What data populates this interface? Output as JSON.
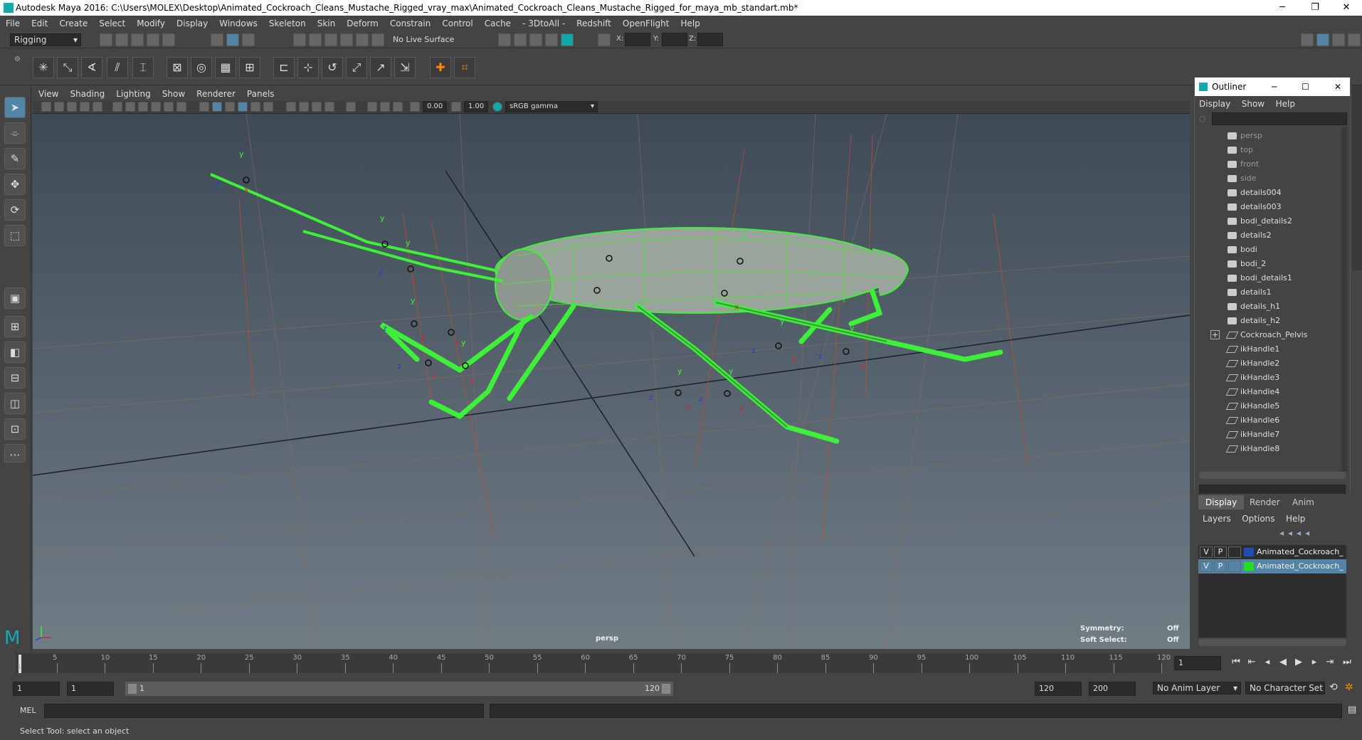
{
  "window": {
    "title": "Autodesk Maya 2016: C:\\Users\\MOLEX\\Desktop\\Animated_Cockroach_Cleans_Mustache_Rigged_vray_max\\Animated_Cockroach_Cleans_Mustache_Rigged_for_maya_mb_standart.mb*",
    "minimize": "─",
    "restore": "❐",
    "close": "✕"
  },
  "menubar": [
    "File",
    "Edit",
    "Create",
    "Select",
    "Modify",
    "Display",
    "Windows",
    "Skeleton",
    "Skin",
    "Deform",
    "Constrain",
    "Control",
    "Cache",
    "- 3DtoAll -",
    "Redshift",
    "OpenFlight",
    "Help"
  ],
  "statusline": {
    "menuset": "Rigging",
    "live_surface": "No Live Surface",
    "x_label": "X:",
    "y_label": "Y:",
    "z_label": "Z:"
  },
  "panel": {
    "menu": [
      "View",
      "Shading",
      "Lighting",
      "Show",
      "Renderer",
      "Panels"
    ],
    "near": "0.00",
    "far": "1.00",
    "colorspace": "sRGB gamma"
  },
  "viewport": {
    "camera_label": "persp",
    "symmetry_label": "Symmetry:",
    "symmetry_value": "Off",
    "softselect_label": "Soft Select:",
    "softselect_value": "Off"
  },
  "outliner": {
    "title": "Outliner",
    "menu": [
      "Display",
      "Show",
      "Help"
    ],
    "items": [
      {
        "label": "persp",
        "type": "cam"
      },
      {
        "label": "top",
        "type": "cam"
      },
      {
        "label": "front",
        "type": "cam"
      },
      {
        "label": "side",
        "type": "cam"
      },
      {
        "label": "details004",
        "type": "mesh"
      },
      {
        "label": "details003",
        "type": "mesh"
      },
      {
        "label": "bodi_details2",
        "type": "mesh"
      },
      {
        "label": "details2",
        "type": "mesh"
      },
      {
        "label": "bodi",
        "type": "mesh"
      },
      {
        "label": "bodi_2",
        "type": "mesh"
      },
      {
        "label": "bodi_details1",
        "type": "mesh"
      },
      {
        "label": "details1",
        "type": "mesh"
      },
      {
        "label": "details_h1",
        "type": "mesh"
      },
      {
        "label": "details_h2",
        "type": "mesh"
      },
      {
        "label": "Cockroach_Pelvis",
        "type": "joint",
        "expand": "+"
      },
      {
        "label": "ikHandle1",
        "type": "joint"
      },
      {
        "label": "ikHandle2",
        "type": "joint"
      },
      {
        "label": "ikHandle3",
        "type": "joint"
      },
      {
        "label": "ikHandle4",
        "type": "joint"
      },
      {
        "label": "ikHandle5",
        "type": "joint"
      },
      {
        "label": "ikHandle6",
        "type": "joint"
      },
      {
        "label": "ikHandle7",
        "type": "joint"
      },
      {
        "label": "ikHandle8",
        "type": "joint"
      }
    ]
  },
  "layers": {
    "tabs": [
      "Display",
      "Render",
      "Anim"
    ],
    "menu": [
      "Layers",
      "Options",
      "Help"
    ],
    "rows": [
      {
        "v": "V",
        "p": "P",
        "color": "#1d4fb8",
        "name": "Animated_Cockroach_"
      },
      {
        "v": "V",
        "p": "P",
        "color": "#22e01a",
        "name": "Animated_Cockroach_"
      }
    ]
  },
  "timeslider": {
    "ticks": [
      "5",
      "10",
      "15",
      "20",
      "25",
      "30",
      "35",
      "40",
      "45",
      "50",
      "55",
      "60",
      "65",
      "70",
      "75",
      "80",
      "85",
      "90",
      "95",
      "100",
      "105",
      "110",
      "115",
      "120"
    ],
    "start_tick": "1",
    "current_frame": "1"
  },
  "rangeslider": {
    "start": "1",
    "anim_start": "1",
    "range_start": "1",
    "range_end": "120",
    "end": "120",
    "anim_end": "200",
    "anim_layer": "No Anim Layer",
    "character_set": "No Character Set"
  },
  "cmdline": {
    "label": "MEL"
  },
  "helpline": {
    "text": "Select Tool: select an object"
  }
}
